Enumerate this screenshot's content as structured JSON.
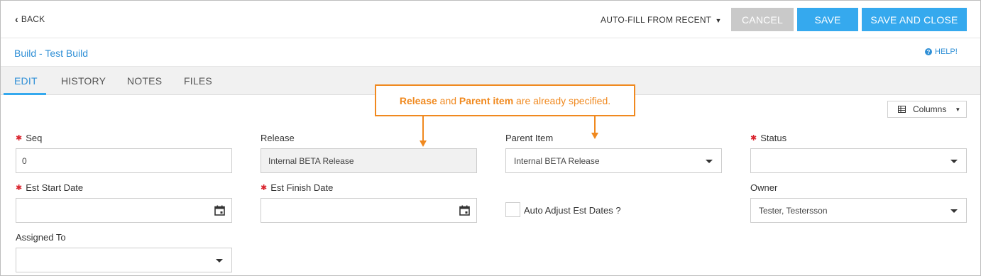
{
  "topbar": {
    "back_label": "BACK",
    "autofill_label": "AUTO-FILL FROM RECENT",
    "cancel_label": "CANCEL",
    "save_label": "SAVE",
    "save_close_label": "SAVE AND CLOSE"
  },
  "header": {
    "title": "Build - Test Build",
    "help_label": "HELP!"
  },
  "tabs": [
    {
      "label": "EDIT",
      "active": true
    },
    {
      "label": "HISTORY",
      "active": false
    },
    {
      "label": "NOTES",
      "active": false
    },
    {
      "label": "FILES",
      "active": false
    }
  ],
  "columns_label": "Columns",
  "callout": {
    "part1": "Release",
    "part2": " and ",
    "part3": "Parent item",
    "part4": " are already specified."
  },
  "fields": {
    "seq": {
      "label": "Seq",
      "value": "0",
      "required": true
    },
    "release": {
      "label": "Release",
      "value": "Internal BETA Release",
      "disabled": true
    },
    "parent_item": {
      "label": "Parent Item",
      "value": "Internal BETA Release"
    },
    "status": {
      "label": "Status",
      "value": "",
      "required": true
    },
    "est_start_date": {
      "label": "Est Start Date",
      "value": "",
      "required": true
    },
    "est_finish_date": {
      "label": "Est Finish Date",
      "value": "",
      "required": true
    },
    "auto_adjust": {
      "label": "Auto Adjust Est Dates ?",
      "checked": false
    },
    "owner": {
      "label": "Owner",
      "value": "Tester, Testersson"
    },
    "assigned_to": {
      "label": "Assigned To",
      "value": ""
    }
  },
  "colors": {
    "accent": "#35a9ee",
    "link": "#2f8fd6",
    "required": "#d9232d",
    "callout": "#f0891f",
    "cancel_disabled": "#c9c9c9"
  },
  "icons": {
    "back": "chevron-left-icon",
    "autofill_caret": "caret-down-icon",
    "help": "question-circle-icon",
    "columns": "grid-icon",
    "calendar": "calendar-icon",
    "dropdown": "caret-down-icon"
  }
}
